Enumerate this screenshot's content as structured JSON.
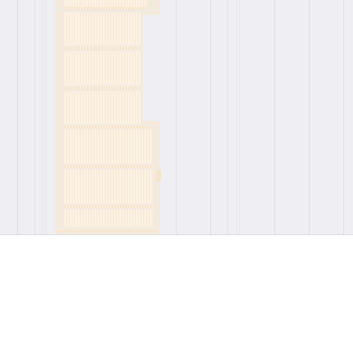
{
  "viewport": {
    "background": "#ffffff",
    "canvas_background": "#efeff3",
    "highlight_color": "#f3eadf"
  }
}
